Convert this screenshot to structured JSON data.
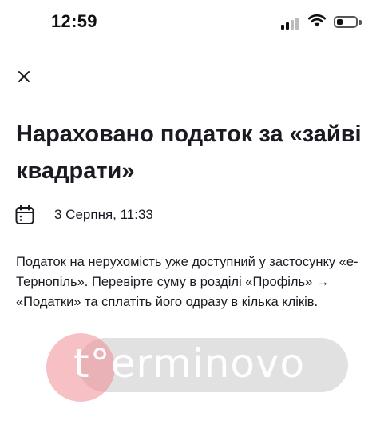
{
  "status_bar": {
    "time": "12:59",
    "icons": [
      "signal-icon",
      "wifi-icon",
      "battery-icon"
    ],
    "battery_level": 0.3
  },
  "close_icon": "close-icon",
  "news": {
    "title": "Нараховано податок за «зайві квадрати»",
    "date_icon": "calendar-icon",
    "date": "3 Серпня, 11:33",
    "body": "Податок на нерухомість уже доступний у застосунку «е-Тернопіль». Перевірте суму в розділі «Профіль» → «Податки» та сплатіть його одразу в кілька кліків."
  },
  "watermark": {
    "text": "t°erminovo"
  },
  "colors": {
    "text": "#1a1b22",
    "watermark_circle": "#f08c96",
    "watermark_pill": "#c8c8c8"
  }
}
